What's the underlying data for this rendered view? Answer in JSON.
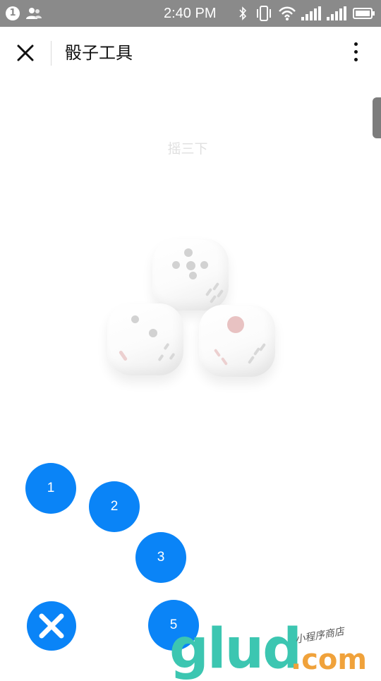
{
  "status_bar": {
    "notification_count": "1",
    "time": "2:40 PM"
  },
  "header": {
    "title": "骰子工具"
  },
  "hint": "摇三下",
  "dice": [
    {
      "value": 5
    },
    {
      "value": 2
    },
    {
      "value": 1
    }
  ],
  "bubbles": [
    "1",
    "2",
    "3",
    "5"
  ],
  "watermark": {
    "main": "glud",
    "domain": ".com",
    "tagline": "小程序商店"
  },
  "colors": {
    "accent": "#0a84f7",
    "status_bar": "#8a8a8a",
    "watermark_green": "#3cc6b1",
    "watermark_orange": "#f0a23b"
  }
}
